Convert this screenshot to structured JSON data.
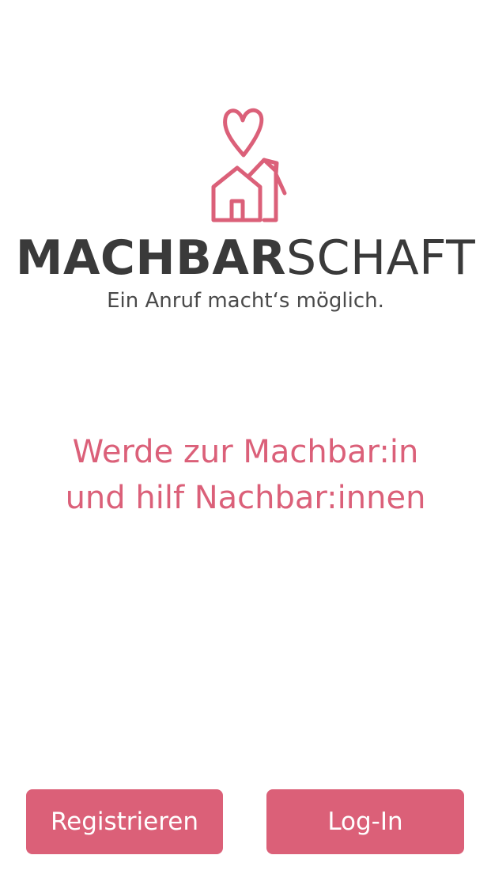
{
  "logo": {
    "icon": "heart-house-icon",
    "wordmark_bold": "MACHBAR",
    "wordmark_light": "SCHAFT",
    "tagline": "Ein Anruf macht‘s möglich."
  },
  "headline": {
    "line1": "Werde zur Machbar:in",
    "line2": "und hilf Nachbar:innen"
  },
  "actions": {
    "register_label": "Registrieren",
    "login_label": "Log-In"
  },
  "colors": {
    "accent": "#db6078",
    "text_dark": "#3a3a3a",
    "background": "#ffffff"
  }
}
